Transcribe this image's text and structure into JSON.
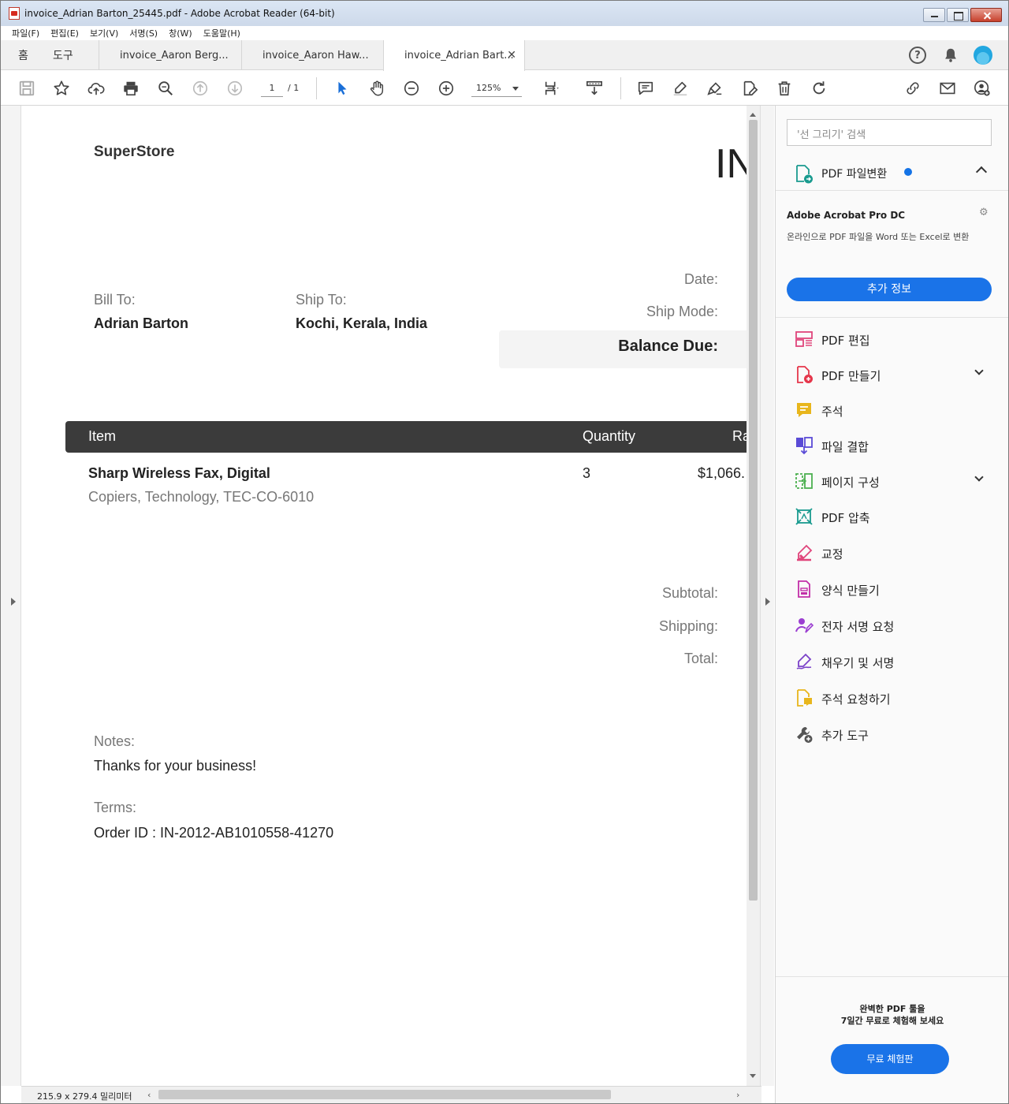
{
  "window": {
    "title": "invoice_Adrian Barton_25445.pdf - Adobe Acrobat Reader (64-bit)"
  },
  "menu": [
    "파일(F)",
    "편집(E)",
    "보기(V)",
    "서명(S)",
    "창(W)",
    "도움말(H)"
  ],
  "nav": {
    "home": "홈",
    "tools": "도구"
  },
  "tabs": [
    {
      "label": "invoice_Aaron Berg..."
    },
    {
      "label": "invoice_Aaron Haw..."
    },
    {
      "label": "invoice_Adrian Bart...",
      "active": true
    }
  ],
  "toolbar": {
    "page_current": "1",
    "page_total": "/ 1",
    "zoom": "125%"
  },
  "invoice": {
    "store": "SuperStore",
    "title": "INVOICE",
    "bill_to_label": "Bill To:",
    "bill_to": "Adrian Barton",
    "ship_to_label": "Ship To:",
    "ship_to": "Kochi, Kerala, India",
    "date_label": "Date:",
    "ship_mode_label": "Ship Mode:",
    "balance_due_label": "Balance Due:",
    "table": {
      "headers": [
        "Item",
        "Quantity",
        "Rate"
      ],
      "rows": [
        {
          "item": "Sharp Wireless Fax, Digital",
          "desc": "Copiers, Technology, TEC-CO-6010",
          "quantity": "3",
          "rate": "$1,066."
        }
      ]
    },
    "subtotal_label": "Subtotal:",
    "shipping_label": "Shipping:",
    "total_label": "Total:",
    "notes_label": "Notes:",
    "notes": "Thanks for your business!",
    "terms_label": "Terms:",
    "terms": "Order ID : IN-2012-AB1010558-41270"
  },
  "status": {
    "dimensions": "215.9 x 279.4 밀리미터"
  },
  "right_panel": {
    "search_placeholder": "'선 그리기' 검색",
    "convert_title": "PDF 파일변환",
    "promo_title": "Adobe Acrobat Pro DC",
    "promo_text": "온라인으로 PDF 파일을 Word 또는 Excel로 변환",
    "more_info": "추가 정보",
    "tools": [
      {
        "label": "PDF 편집",
        "icon": "pdf-edit-icon",
        "color": "#e0457b"
      },
      {
        "label": "PDF 만들기",
        "icon": "pdf-create-icon",
        "color": "#e5364b",
        "expandable": true
      },
      {
        "label": "주석",
        "icon": "comment-icon",
        "color": "#e8b61c"
      },
      {
        "label": "파일 결합",
        "icon": "combine-files-icon",
        "color": "#5a4bd6"
      },
      {
        "label": "페이지 구성",
        "icon": "organize-pages-icon",
        "color": "#4cb050",
        "expandable": true
      },
      {
        "label": "PDF 압축",
        "icon": "compress-pdf-icon",
        "color": "#1a9b8f"
      },
      {
        "label": "교정",
        "icon": "redact-icon",
        "color": "#e0457b"
      },
      {
        "label": "양식 만들기",
        "icon": "prepare-form-icon",
        "color": "#c22fa8"
      },
      {
        "label": "전자 서명 요청",
        "icon": "request-signature-icon",
        "color": "#9b3fd1"
      },
      {
        "label": "채우기 및 서명",
        "icon": "fill-sign-icon",
        "color": "#7b42c9"
      },
      {
        "label": "주석 요청하기",
        "icon": "send-comments-icon",
        "color": "#e8b61c"
      },
      {
        "label": "추가 도구",
        "icon": "more-tools-icon",
        "color": "#555555"
      }
    ],
    "trial_text_1": "완벽한 PDF 툴을",
    "trial_text_2": "7일간 무료로 체험해 보세요",
    "trial_button": "무료 체험판"
  }
}
